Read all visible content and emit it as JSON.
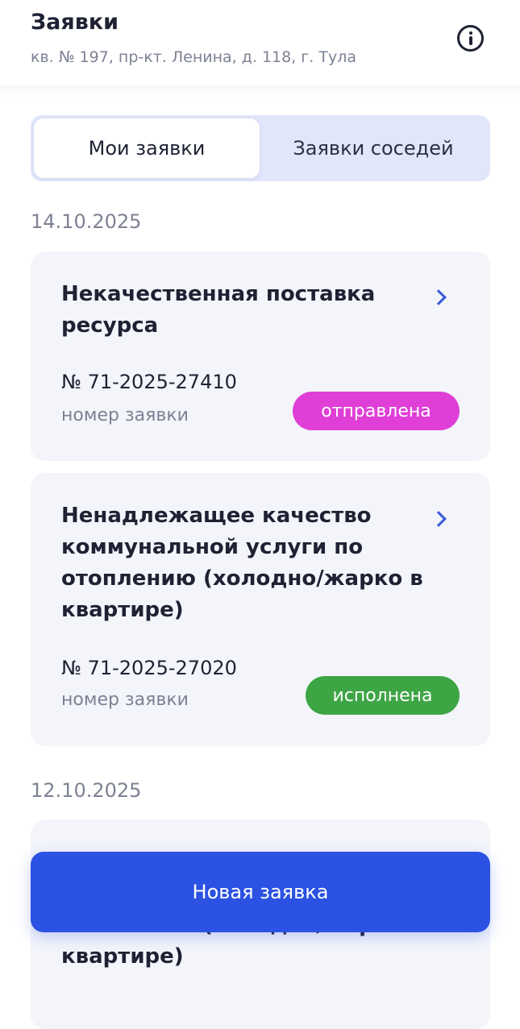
{
  "header": {
    "title": "Заявки",
    "address": "кв. № 197, пр-кт. Ленина, д. 118, г. Тула",
    "info_icon": "info-circle-icon"
  },
  "tabs": {
    "active": "Мои заявки",
    "inactive": "Заявки соседей"
  },
  "groups": [
    {
      "date": "14.10.2025",
      "requests": [
        {
          "title": "Некачественная поставка ресурса",
          "number": "№ 71-2025-27410",
          "number_caption": "номер заявки",
          "status": "отправлена",
          "status_color": "#df3fd6"
        },
        {
          "title": "Ненадлежащее качество коммунальной услуги по отоплению (холодно/жарко в квартире)",
          "number": "№ 71-2025-27020",
          "number_caption": "номер заявки",
          "status": "исполнена",
          "status_color": "#3ea545"
        }
      ]
    },
    {
      "date": "12.10.2025",
      "requests": [
        {
          "title": "Ненадлежащее качество коммунальной услуги по отоплению (холодно/жарко в квартире)"
        }
      ]
    }
  ],
  "new_request_button": "Новая заявка",
  "colors": {
    "accent": "#2c52e3",
    "segment_bg": "#e2e6fb",
    "card_bg": "#f3f5fb",
    "chevron": "#3a5bd8"
  }
}
